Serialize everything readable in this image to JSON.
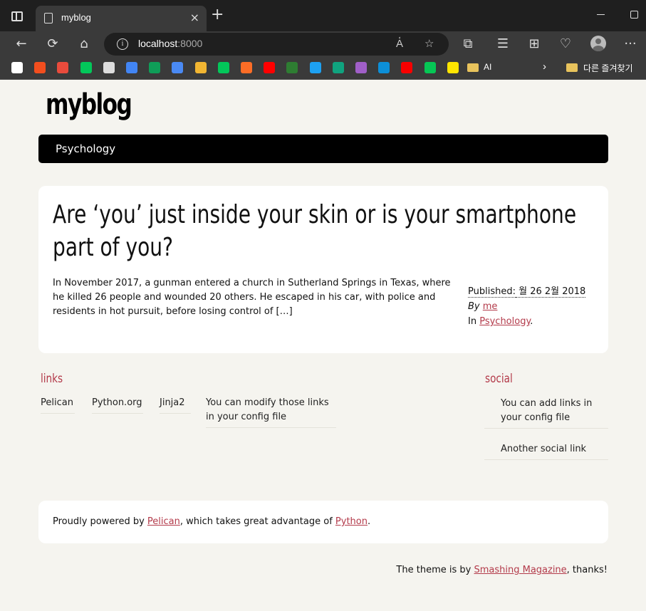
{
  "browser": {
    "tab_title": "myblog",
    "tab_close": "×",
    "new_tab": "+",
    "url_host": "localhost",
    "url_port": ":8000",
    "nav": {
      "back": "←",
      "reload": "⟳",
      "home": "⌂",
      "more": "···"
    },
    "bookmarks": [
      {
        "icon": "notion-icon",
        "color": "#ffffff"
      },
      {
        "icon": "figma-icon",
        "color": "#f24e1e"
      },
      {
        "icon": "app-icon",
        "color": "#e94b3c"
      },
      {
        "icon": "blog-icon",
        "color": "#03c75a"
      },
      {
        "icon": "globe-icon",
        "color": "#dddddd"
      },
      {
        "icon": "google-icon",
        "color": "#4285f4"
      },
      {
        "icon": "drive-icon",
        "color": "#0f9d58"
      },
      {
        "icon": "store-icon",
        "color": "#4a8af4"
      },
      {
        "icon": "d-icon",
        "color": "#f2b632"
      },
      {
        "icon": "naver-icon",
        "color": "#03c75a"
      },
      {
        "icon": "gitlab-icon",
        "color": "#fc6d26"
      },
      {
        "icon": "youtube-icon",
        "color": "#ff0000"
      },
      {
        "icon": "game-icon",
        "color": "#2e7d32"
      },
      {
        "icon": "bird-icon",
        "color": "#1da1f2"
      },
      {
        "icon": "openai-icon",
        "color": "#10a37f"
      },
      {
        "icon": "grid-icon",
        "color": "#a05fc8"
      },
      {
        "icon": "edge-icon",
        "color": "#0c8fd8"
      },
      {
        "icon": "oracle-icon",
        "color": "#f80000"
      },
      {
        "icon": "line-icon",
        "color": "#06c755"
      },
      {
        "icon": "kakao-icon",
        "color": "#fee500"
      }
    ],
    "bookmark_folder_label": "AI",
    "other_bookmarks_label": "다른 즐겨찾기"
  },
  "site": {
    "title": "myblog",
    "menu": [
      "Psychology"
    ]
  },
  "article": {
    "title": "Are ‘you’ just inside your skin or is your smartphone part of you?",
    "summary": "In November 2017, a gunman entered a church in Sutherland Springs in Texas, where he killed 26 people and wounded 20 others. He escaped in his car, with police and residents in hot pursuit, before losing control of […]",
    "published_label": "Published:",
    "published_date": "월 26 2월 2018",
    "by_label": "By",
    "author": "me",
    "in_label": "In",
    "category": "Psychology",
    "period": "."
  },
  "blogroll": {
    "heading": "links",
    "items": [
      "Pelican",
      "Python.org",
      "Jinja2",
      "You can modify those links in your config file"
    ]
  },
  "social": {
    "heading": "social",
    "items": [
      "You can add links in your config file",
      "Another social link"
    ]
  },
  "footer": {
    "prefix": "Proudly powered by",
    "pelican": "Pelican",
    "middle": ", which takes great advantage of",
    "python": "Python",
    "suffix": "."
  },
  "credit": {
    "prefix": "The theme is by",
    "author": "Smashing Magazine",
    "suffix": ", thanks!"
  }
}
